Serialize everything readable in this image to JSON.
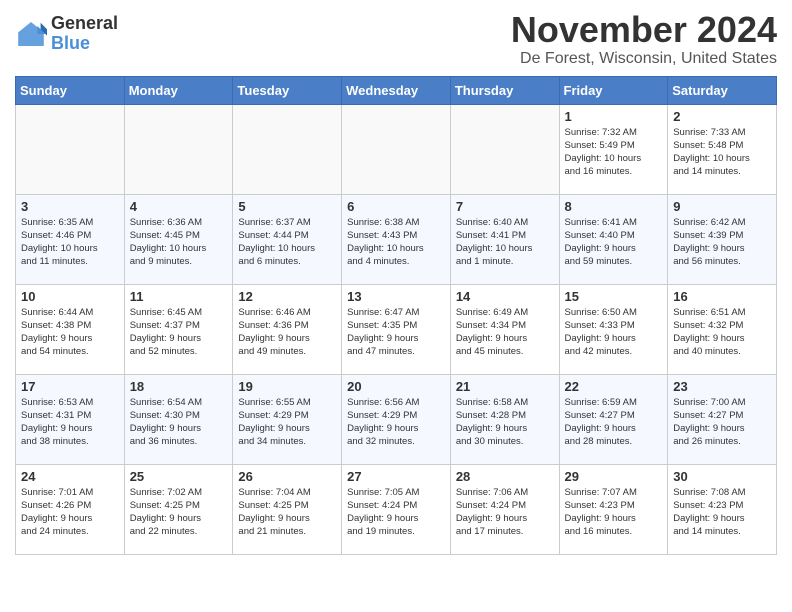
{
  "app": {
    "logo_general": "General",
    "logo_blue": "Blue",
    "title": "November 2024",
    "subtitle": "De Forest, Wisconsin, United States"
  },
  "calendar": {
    "headers": [
      "Sunday",
      "Monday",
      "Tuesday",
      "Wednesday",
      "Thursday",
      "Friday",
      "Saturday"
    ],
    "weeks": [
      [
        {
          "day": "",
          "info": ""
        },
        {
          "day": "",
          "info": ""
        },
        {
          "day": "",
          "info": ""
        },
        {
          "day": "",
          "info": ""
        },
        {
          "day": "",
          "info": ""
        },
        {
          "day": "1",
          "info": "Sunrise: 7:32 AM\nSunset: 5:49 PM\nDaylight: 10 hours\nand 16 minutes."
        },
        {
          "day": "2",
          "info": "Sunrise: 7:33 AM\nSunset: 5:48 PM\nDaylight: 10 hours\nand 14 minutes."
        }
      ],
      [
        {
          "day": "3",
          "info": "Sunrise: 6:35 AM\nSunset: 4:46 PM\nDaylight: 10 hours\nand 11 minutes."
        },
        {
          "day": "4",
          "info": "Sunrise: 6:36 AM\nSunset: 4:45 PM\nDaylight: 10 hours\nand 9 minutes."
        },
        {
          "day": "5",
          "info": "Sunrise: 6:37 AM\nSunset: 4:44 PM\nDaylight: 10 hours\nand 6 minutes."
        },
        {
          "day": "6",
          "info": "Sunrise: 6:38 AM\nSunset: 4:43 PM\nDaylight: 10 hours\nand 4 minutes."
        },
        {
          "day": "7",
          "info": "Sunrise: 6:40 AM\nSunset: 4:41 PM\nDaylight: 10 hours\nand 1 minute."
        },
        {
          "day": "8",
          "info": "Sunrise: 6:41 AM\nSunset: 4:40 PM\nDaylight: 9 hours\nand 59 minutes."
        },
        {
          "day": "9",
          "info": "Sunrise: 6:42 AM\nSunset: 4:39 PM\nDaylight: 9 hours\nand 56 minutes."
        }
      ],
      [
        {
          "day": "10",
          "info": "Sunrise: 6:44 AM\nSunset: 4:38 PM\nDaylight: 9 hours\nand 54 minutes."
        },
        {
          "day": "11",
          "info": "Sunrise: 6:45 AM\nSunset: 4:37 PM\nDaylight: 9 hours\nand 52 minutes."
        },
        {
          "day": "12",
          "info": "Sunrise: 6:46 AM\nSunset: 4:36 PM\nDaylight: 9 hours\nand 49 minutes."
        },
        {
          "day": "13",
          "info": "Sunrise: 6:47 AM\nSunset: 4:35 PM\nDaylight: 9 hours\nand 47 minutes."
        },
        {
          "day": "14",
          "info": "Sunrise: 6:49 AM\nSunset: 4:34 PM\nDaylight: 9 hours\nand 45 minutes."
        },
        {
          "day": "15",
          "info": "Sunrise: 6:50 AM\nSunset: 4:33 PM\nDaylight: 9 hours\nand 42 minutes."
        },
        {
          "day": "16",
          "info": "Sunrise: 6:51 AM\nSunset: 4:32 PM\nDaylight: 9 hours\nand 40 minutes."
        }
      ],
      [
        {
          "day": "17",
          "info": "Sunrise: 6:53 AM\nSunset: 4:31 PM\nDaylight: 9 hours\nand 38 minutes."
        },
        {
          "day": "18",
          "info": "Sunrise: 6:54 AM\nSunset: 4:30 PM\nDaylight: 9 hours\nand 36 minutes."
        },
        {
          "day": "19",
          "info": "Sunrise: 6:55 AM\nSunset: 4:29 PM\nDaylight: 9 hours\nand 34 minutes."
        },
        {
          "day": "20",
          "info": "Sunrise: 6:56 AM\nSunset: 4:29 PM\nDaylight: 9 hours\nand 32 minutes."
        },
        {
          "day": "21",
          "info": "Sunrise: 6:58 AM\nSunset: 4:28 PM\nDaylight: 9 hours\nand 30 minutes."
        },
        {
          "day": "22",
          "info": "Sunrise: 6:59 AM\nSunset: 4:27 PM\nDaylight: 9 hours\nand 28 minutes."
        },
        {
          "day": "23",
          "info": "Sunrise: 7:00 AM\nSunset: 4:27 PM\nDaylight: 9 hours\nand 26 minutes."
        }
      ],
      [
        {
          "day": "24",
          "info": "Sunrise: 7:01 AM\nSunset: 4:26 PM\nDaylight: 9 hours\nand 24 minutes."
        },
        {
          "day": "25",
          "info": "Sunrise: 7:02 AM\nSunset: 4:25 PM\nDaylight: 9 hours\nand 22 minutes."
        },
        {
          "day": "26",
          "info": "Sunrise: 7:04 AM\nSunset: 4:25 PM\nDaylight: 9 hours\nand 21 minutes."
        },
        {
          "day": "27",
          "info": "Sunrise: 7:05 AM\nSunset: 4:24 PM\nDaylight: 9 hours\nand 19 minutes."
        },
        {
          "day": "28",
          "info": "Sunrise: 7:06 AM\nSunset: 4:24 PM\nDaylight: 9 hours\nand 17 minutes."
        },
        {
          "day": "29",
          "info": "Sunrise: 7:07 AM\nSunset: 4:23 PM\nDaylight: 9 hours\nand 16 minutes."
        },
        {
          "day": "30",
          "info": "Sunrise: 7:08 AM\nSunset: 4:23 PM\nDaylight: 9 hours\nand 14 minutes."
        }
      ]
    ]
  }
}
